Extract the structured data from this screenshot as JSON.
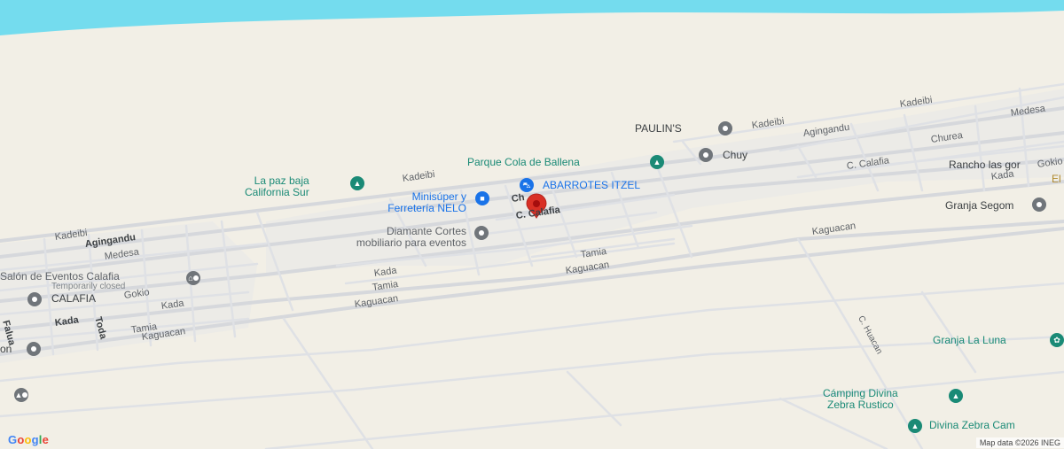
{
  "map": {
    "colors": {
      "land": "#f2efe6",
      "water": "#74dcee",
      "road": "#dadce0",
      "road_border": "#c9cdd2",
      "urban": "#ededea",
      "poi_green": "#1a8a76",
      "poi_blue": "#1a73e8",
      "pin": "#d93025"
    },
    "streets": {
      "kadeibi_1": "Kadeibi",
      "kadeibi_2": "Kadeibi",
      "kadeibi_3": "Kadeibi",
      "kadeibi_4": "Kadeibi",
      "agingandu_1": "Agingandu",
      "agingandu_2": "Agingandu",
      "medesa_1": "Medesa",
      "medesa_2": "Medesa",
      "churea": "Churea",
      "calafia_1": "C. Calafia",
      "calafia_2": "C. Calafia",
      "calafia_3": "Ch",
      "kada_1": "Kada",
      "kada_2": "Kada",
      "kada_3": "Kada",
      "kada_4": "Kada",
      "tamia_1": "Tamia",
      "tamia_2": "Tamia",
      "tamia_3": "Tamia",
      "kaguacan_1": "Kaguacan",
      "kaguacan_2": "Kaguacan",
      "kaguacan_3": "Kaguacan",
      "kaguacan_4": "Kaguacan",
      "gokio_1": "Gokio",
      "gokio_2": "Gokio",
      "falua": "Falua",
      "toda": "Toda",
      "huacan": "C. Huacan"
    },
    "pois": {
      "paulins": "PAULIN'S",
      "parque": "Parque Cola de Ballena",
      "chuy": "Chuy",
      "lapaz_1": "La paz baja",
      "lapaz_2": "California Sur",
      "minisuper_1": "Minisúper y",
      "minisuper_2": "Ferretería NELO",
      "abarrotes": "ABARROTES ITZEL",
      "diamante_1": "Diamante Cortes",
      "diamante_2": "mobiliario para eventos",
      "salon": "Salón de Eventos Calafia",
      "salon_status": "Temporarily closed",
      "calafia_poi": "CALAFIA",
      "on": "on",
      "rancho": "Rancho las gor",
      "el": "El",
      "granja_segom": "Granja Segom",
      "granja_luna": "Granja La Luna",
      "camping_1": "Cámping Divina",
      "camping_2": "Zebra Rustico",
      "divina": "Divina Zebra Cam"
    },
    "icons": {
      "paulins": "bank-icon",
      "parque": "park-icon",
      "chuy": "place-icon",
      "lapaz": "park-icon",
      "minisuper": "shopping-bag-icon",
      "abarrotes": "shopping-cart-icon",
      "diamante": "place-icon",
      "salon": "event-venue-icon",
      "calafia": "place-icon",
      "granja_segom": "place-icon",
      "granja_luna": "place-icon",
      "camping": "campground-icon",
      "divina": "campground-icon",
      "school": "school-icon",
      "pin": "location-pin-icon"
    },
    "attribution": "Map data ©2026 INEG"
  }
}
